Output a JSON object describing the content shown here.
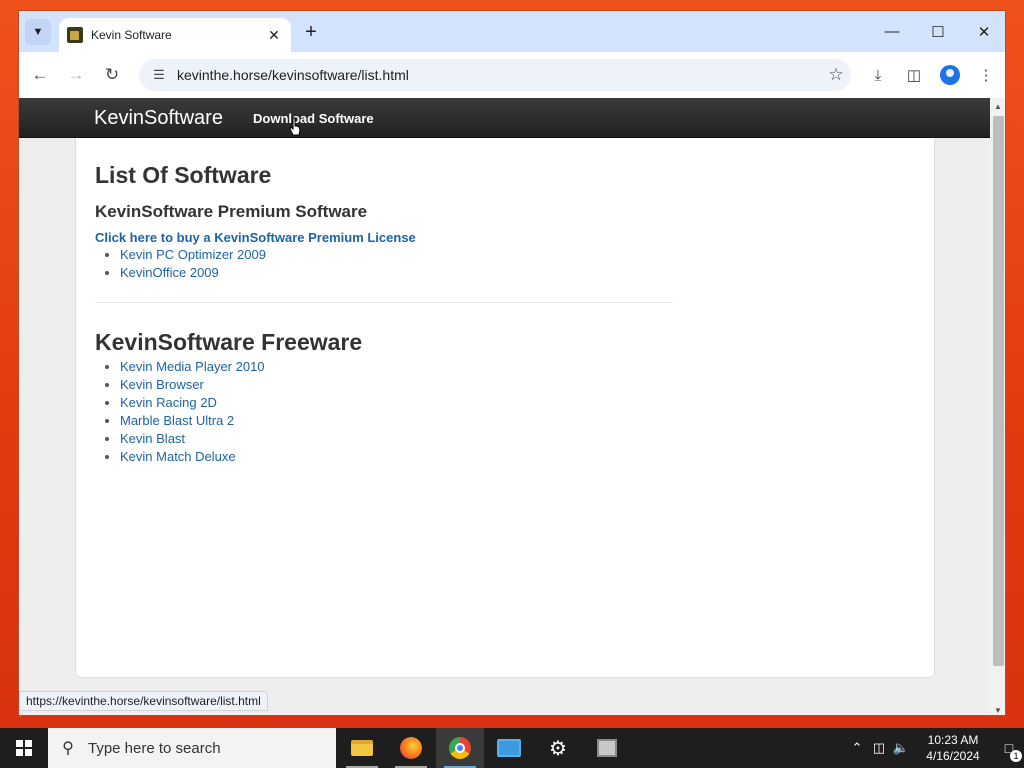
{
  "browser": {
    "tab_title": "Kevin Software",
    "url": "kevinthe.horse/kevinsoftware/list.html",
    "status_url": "https://kevinthe.horse/kevinsoftware/list.html"
  },
  "site": {
    "brand": "KevinSoftware",
    "nav_link": "Download Software",
    "heading": "List Of Software",
    "premium_heading": "KevinSoftware Premium Software",
    "buy_link": "Click here to buy a KevinSoftware Premium License",
    "premium_items": [
      "Kevin PC Optimizer 2009",
      "KevinOffice 2009"
    ],
    "freeware_heading": "KevinSoftware Freeware",
    "freeware_items": [
      "Kevin Media Player 2010",
      "Kevin Browser",
      "Kevin Racing 2D",
      "Marble Blast Ultra 2",
      "Kevin Blast",
      "Kevin Match Deluxe"
    ]
  },
  "taskbar": {
    "search_placeholder": "Type here to search",
    "time": "10:23 AM",
    "date": "4/16/2024",
    "notification_count": "1"
  },
  "colors": {
    "link": "#1c63a8",
    "navbar": "#222222",
    "tabstrip": "#d3e3fd",
    "desktop": "#e8431a"
  },
  "icons": {
    "back": "back-arrow-icon",
    "forward": "forward-arrow-icon",
    "reload": "reload-icon",
    "bookmark": "star-icon",
    "download": "download-icon",
    "side_panel": "side-panel-icon",
    "menu": "kebab-menu-icon"
  }
}
